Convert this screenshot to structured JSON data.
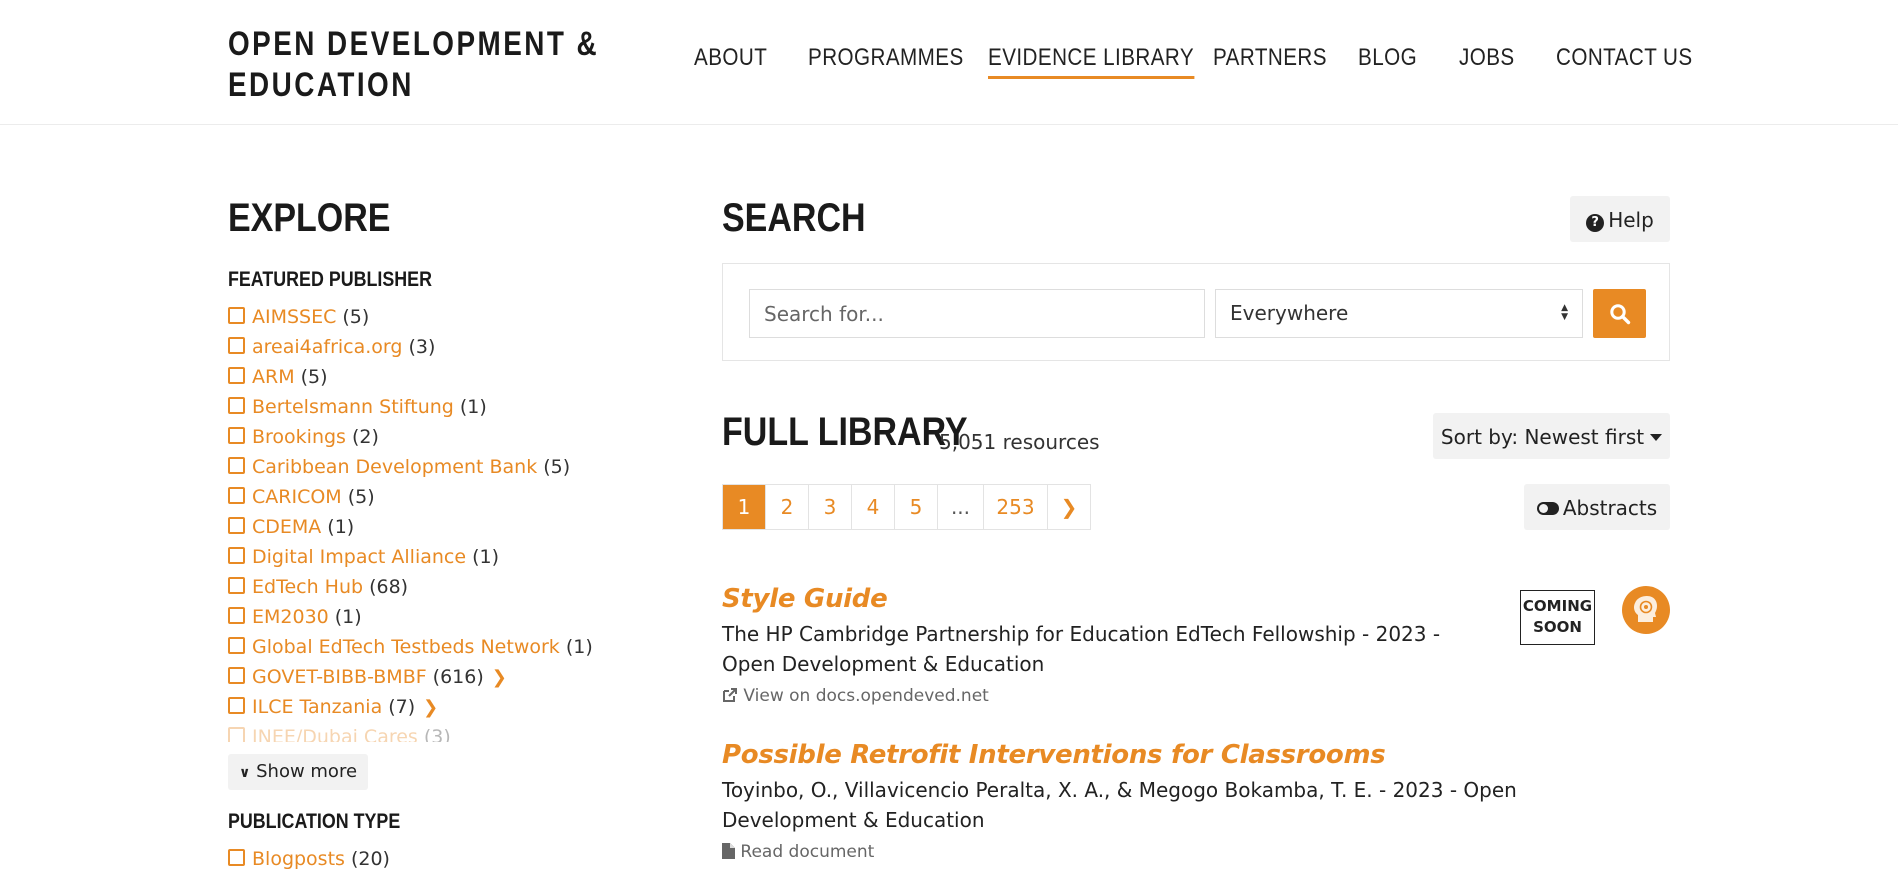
{
  "header": {
    "logo_line1": "OPEN DEVELOPMENT &",
    "logo_line2": "EDUCATION",
    "nav": [
      "ABOUT",
      "PROGRAMMES",
      "EVIDENCE LIBRARY",
      "PARTNERS",
      "BLOG",
      "JOBS",
      "CONTACT US"
    ],
    "active_nav": "EVIDENCE LIBRARY"
  },
  "explore": {
    "title": "EXPLORE",
    "featured_publisher_title": "FEATURED PUBLISHER",
    "publishers": [
      {
        "label": "AIMSSEC",
        "count": "(5)"
      },
      {
        "label": "areai4africa.org",
        "count": "(3)"
      },
      {
        "label": "ARM",
        "count": "(5)"
      },
      {
        "label": "Bertelsmann Stiftung",
        "count": "(1)"
      },
      {
        "label": "Brookings",
        "count": "(2)"
      },
      {
        "label": "Caribbean Development Bank",
        "count": "(5)"
      },
      {
        "label": "CARICOM",
        "count": "(5)"
      },
      {
        "label": "CDEMA",
        "count": "(1)"
      },
      {
        "label": "Digital Impact Alliance",
        "count": "(1)"
      },
      {
        "label": "EdTech Hub",
        "count": "(68)"
      },
      {
        "label": "EM2030",
        "count": "(1)"
      },
      {
        "label": "Global EdTech Testbeds Network",
        "count": "(1)"
      },
      {
        "label": "GOVET-BIBB-BMBF",
        "count": "(616)"
      },
      {
        "label": "ILCE Tanzania",
        "count": "(7)"
      },
      {
        "label": "INEE/Dubai Cares",
        "count": "(3)"
      }
    ],
    "show_more": "Show more",
    "publication_type_title": "PUBLICATION TYPE",
    "publication_types": [
      {
        "label": "Blogposts",
        "count": "(20)"
      }
    ]
  },
  "search": {
    "title": "SEARCH",
    "help_label": "Help",
    "placeholder": "Search for...",
    "scope": "Everywhere"
  },
  "library": {
    "title": "FULL LIBRARY",
    "count": "5,051 resources",
    "sort_label": "Sort by: Newest first",
    "pages": [
      "1",
      "2",
      "3",
      "4",
      "5",
      "...",
      "253"
    ],
    "current_page": "1",
    "abstracts_label": "Abstracts"
  },
  "results": [
    {
      "title": "Style Guide",
      "meta": "The HP Cambridge Partnership for Education EdTech Fellowship - 2023 - Open Development & Education",
      "link": "View on docs.opendeved.net",
      "badge": "COMING SOON"
    },
    {
      "title": "Possible Retrofit Interventions for Classrooms",
      "meta": "Toyinbo, O., Villavicencio Peralta, X. A., & Megogo Bokamba, T. E. - 2023 - Open Development & Education",
      "link": "Read document"
    }
  ],
  "colors": {
    "accent": "#e88a24",
    "text": "#212529",
    "button_bg": "#f2f2f2"
  }
}
